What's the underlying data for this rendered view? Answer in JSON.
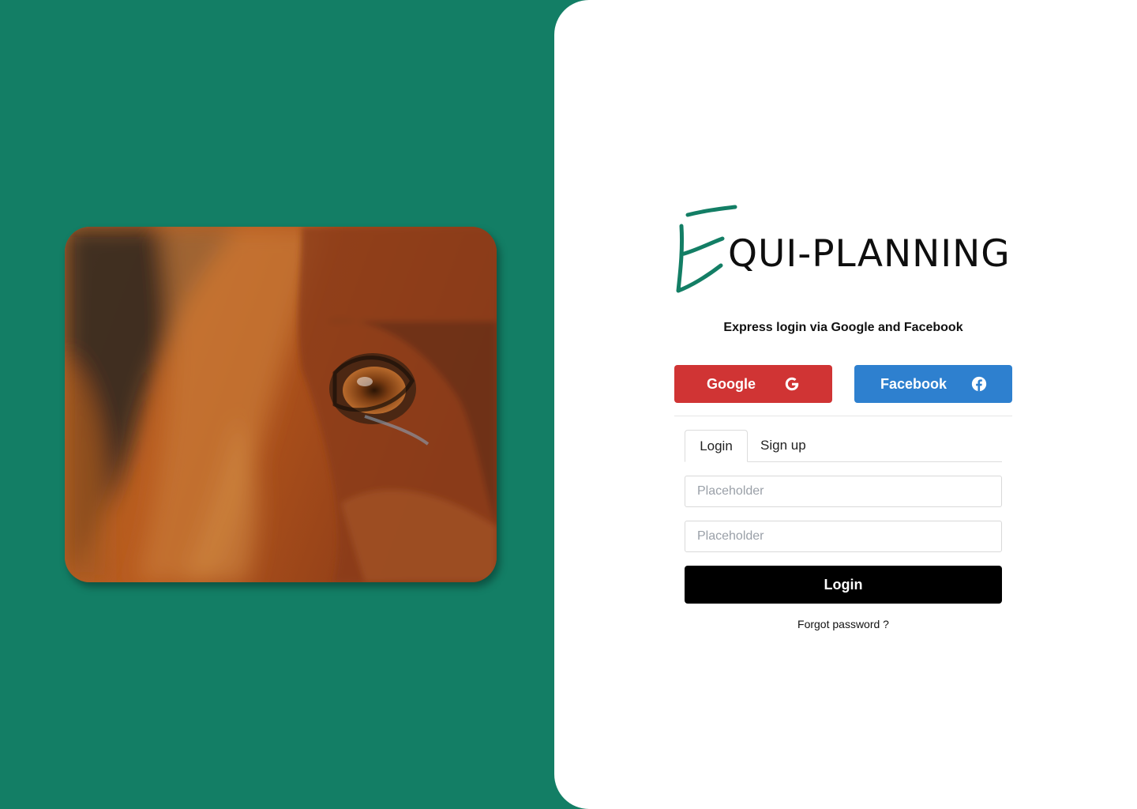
{
  "brand": {
    "name": "QUI-PLANNING",
    "accent_color": "#137e65",
    "logo_icon": "script-e-logo"
  },
  "hero": {
    "image_icon": "horse-eye-photo"
  },
  "express": {
    "text": "Express login via Google and Facebook"
  },
  "social": {
    "google_label": "Google",
    "google_icon": "google-g-icon",
    "google_color": "#d03434",
    "facebook_label": "Facebook",
    "facebook_icon": "facebook-icon",
    "facebook_color": "#2e80cf"
  },
  "tabs": {
    "login": "Login",
    "signup": "Sign up",
    "active": "Login"
  },
  "form": {
    "field1_placeholder": "Placeholder",
    "field2_placeholder": "Placeholder",
    "submit_label": "Login",
    "forgot_label": "Forgot password ?"
  }
}
